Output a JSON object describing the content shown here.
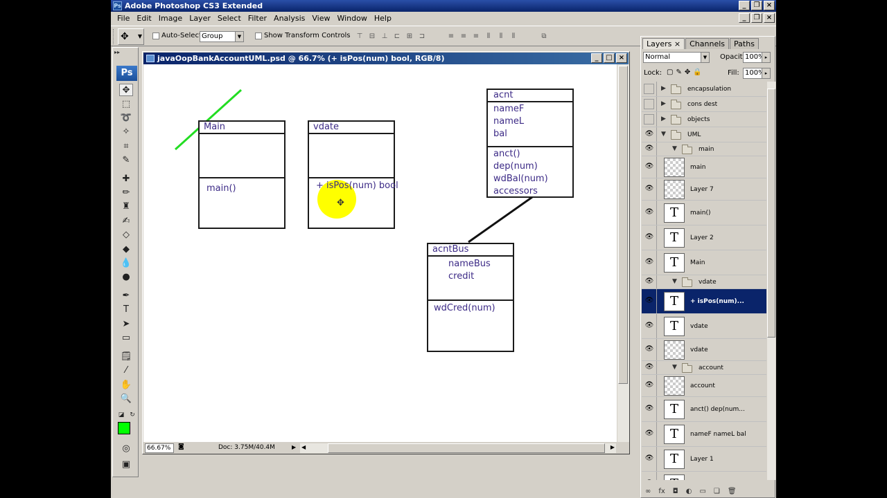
{
  "app": {
    "title": "Adobe Photoshop CS3 Extended",
    "logo": "Ps"
  },
  "menu": [
    "File",
    "Edit",
    "Image",
    "Layer",
    "Select",
    "Filter",
    "Analysis",
    "View",
    "Window",
    "Help"
  ],
  "options": {
    "auto_select_label": "Auto-Select:",
    "auto_select_value": "Group",
    "show_transform_label": "Show Transform Controls"
  },
  "document": {
    "title": "javaOopBankAccountUML.psd @ 66.7% (+ isPos(num) bool, RGB/8)",
    "zoom": "66.67%",
    "doc_info": "Doc: 3.75M/40.4M"
  },
  "uml": {
    "main": {
      "title": "Main",
      "methods": [
        "main()"
      ]
    },
    "vdate": {
      "title": "vdate",
      "methods": [
        "+ isPos(num) bool"
      ]
    },
    "acnt": {
      "title": "acnt",
      "fields": [
        "nameF",
        "nameL",
        "bal"
      ],
      "methods": [
        "anct()",
        "dep(num)",
        "wdBal(num)",
        "accessors"
      ]
    },
    "acntBus": {
      "title": "acntBus",
      "fields": [
        "nameBus",
        "credit"
      ],
      "methods": [
        "wdCred(num)"
      ]
    }
  },
  "colors": {
    "foreground": "#00ff00",
    "highlight": "#ffff00",
    "uml_text": "#3c2a86"
  },
  "layers_panel": {
    "tabs": [
      "Layers ×",
      "Channels",
      "Paths"
    ],
    "blend_mode": "Normal",
    "opacity_label": "Opacity:",
    "opacity": "100%",
    "lock_label": "Lock:",
    "fill_label": "Fill:",
    "fill": "100%",
    "rows": [
      {
        "name": "encapsulation",
        "kind": "group",
        "visible": false,
        "expanded": false
      },
      {
        "name": "cons dest",
        "kind": "group",
        "visible": false,
        "expanded": false
      },
      {
        "name": "objects",
        "kind": "group",
        "visible": false,
        "expanded": false
      },
      {
        "name": "UML",
        "kind": "group",
        "visible": true,
        "expanded": true
      },
      {
        "name": "main",
        "kind": "subgroup",
        "visible": true,
        "expanded": true
      },
      {
        "name": "main",
        "kind": "pixel",
        "visible": true
      },
      {
        "name": "Layer 7",
        "kind": "pixel",
        "visible": true
      },
      {
        "name": "main()",
        "kind": "text",
        "visible": true
      },
      {
        "name": "Layer 2",
        "kind": "text",
        "visible": true
      },
      {
        "name": "Main",
        "kind": "text",
        "visible": true
      },
      {
        "name": "vdate",
        "kind": "subgroup",
        "visible": true,
        "expanded": true
      },
      {
        "name": "+ isPos(num)...",
        "kind": "text",
        "visible": true,
        "selected": true
      },
      {
        "name": "vdate",
        "kind": "text",
        "visible": true
      },
      {
        "name": "vdate",
        "kind": "pixel",
        "visible": true
      },
      {
        "name": "account",
        "kind": "subgroup",
        "visible": true,
        "expanded": true
      },
      {
        "name": "account",
        "kind": "pixel",
        "visible": true
      },
      {
        "name": "anct() dep(num...",
        "kind": "text",
        "visible": true
      },
      {
        "name": "nameF nameL bal",
        "kind": "text",
        "visible": true
      },
      {
        "name": "Layer 1",
        "kind": "text",
        "visible": true
      },
      {
        "name": "",
        "kind": "text",
        "visible": true
      }
    ]
  }
}
